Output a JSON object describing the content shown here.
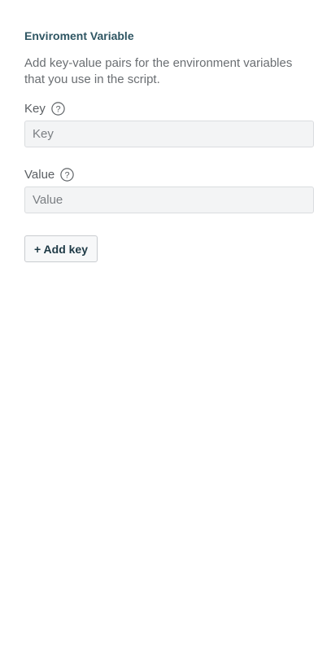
{
  "section": {
    "title": "Enviroment Variable",
    "description": "Add key-value pairs for the environment variables that you use in the script."
  },
  "fields": {
    "key": {
      "label": "Key",
      "placeholder": "Key",
      "value": "",
      "help_icon": "question-circle-icon"
    },
    "value": {
      "label": "Value",
      "placeholder": "Value",
      "value": "",
      "help_icon": "question-circle-icon"
    }
  },
  "actions": {
    "add_key_label": "+ Add key"
  },
  "colors": {
    "title": "#2f5663",
    "input_background": "#f3f4f5",
    "button_text": "#1e3a46"
  }
}
